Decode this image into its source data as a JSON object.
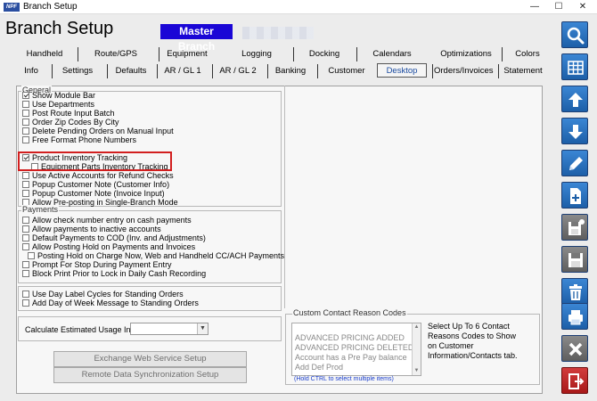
{
  "window": {
    "logo_text": "NPF",
    "title": "Branch Setup",
    "controls": [
      "—",
      "☐",
      "✕"
    ]
  },
  "header": {
    "page_title": "Branch Setup",
    "branch_name": "Master Branch"
  },
  "tabs_row1": [
    "Handheld",
    "Route/GPS",
    "Equipment",
    "Logging",
    "Docking",
    "Calendars",
    "Optimizations",
    "Colors"
  ],
  "tabs_row2": [
    "Info",
    "Settings",
    "Defaults",
    "AR / GL 1",
    "AR / GL 2",
    "Banking",
    "Customer",
    "Desktop",
    "Orders/Invoices",
    "Statement"
  ],
  "active_tab": "Desktop",
  "general": {
    "label": "General",
    "options": [
      {
        "label": "Show Module Bar",
        "checked": true,
        "indent": false
      },
      {
        "label": "Use Departments",
        "checked": false,
        "indent": false
      },
      {
        "label": "Post Route Input Batch",
        "checked": false,
        "indent": false
      },
      {
        "label": "Order Zip Codes By City",
        "checked": false,
        "indent": false
      },
      {
        "label": "Delete Pending Orders on Manual Input",
        "checked": false,
        "indent": false
      },
      {
        "label": "Free Format Phone Numbers",
        "checked": false,
        "indent": false
      },
      {
        "label": "",
        "checked": false,
        "indent": false,
        "blank": true
      },
      {
        "label": "Product Inventory Tracking",
        "checked": true,
        "indent": false
      },
      {
        "label": "Equipment Parts Inventory Tracking",
        "checked": false,
        "indent": true
      },
      {
        "label": "Use Active Accounts for Refund Checks",
        "checked": false,
        "indent": false
      },
      {
        "label": "Popup Customer Note (Customer Info)",
        "checked": false,
        "indent": false
      },
      {
        "label": "Popup Customer Note (Invoice Input)",
        "checked": false,
        "indent": false
      },
      {
        "label": "Allow Pre-posting in Single-Branch Mode",
        "checked": false,
        "indent": false
      }
    ]
  },
  "payments": {
    "label": "Payments",
    "options": [
      {
        "label": "Allow check number entry on cash payments",
        "checked": false,
        "indent": false
      },
      {
        "label": "Allow payments to inactive accounts",
        "checked": false,
        "indent": false
      },
      {
        "label": "Default Payments to COD (Inv. and Adjustments)",
        "checked": false,
        "indent": false
      },
      {
        "label": "Allow Posting Hold on Payments and Invoices",
        "checked": false,
        "indent": false
      },
      {
        "label": "Posting Hold on Charge Now, Web and Handheld CC/ACH Payments",
        "checked": false,
        "indent": true
      },
      {
        "label": "Prompt For Stop During Payment Entry",
        "checked": false,
        "indent": false
      },
      {
        "label": "Block Print Prior to Lock in Daily Cash Recording",
        "checked": false,
        "indent": false
      }
    ]
  },
  "standing_orders": {
    "options": [
      {
        "label": "Use Day Label Cycles for Standing Orders",
        "checked": false
      },
      {
        "label": "Add Day of Week Message to Standing Orders",
        "checked": false
      }
    ]
  },
  "usage": {
    "label": "Calculate Estimated Usage In",
    "value": ""
  },
  "buttons": {
    "exchange": "Exchange Web Service Setup",
    "remote": "Remote Data Synchronization Setup"
  },
  "reason_codes": {
    "label": "Custom Contact Reason Codes",
    "items": [
      "",
      "ADVANCED PRICING ADDED",
      "ADVANCED PRICING DELETED",
      "Account has a Pre Pay balance",
      "Add Def Prod"
    ],
    "hint": "(Hold CTRL to select multiple items)",
    "description": "Select Up To 6 Contact Reasons Codes to Show on Customer Information/Contacts tab."
  },
  "toolbar": [
    {
      "icon": "search-icon",
      "color": "#2a6fbf"
    },
    {
      "icon": "grid-icon",
      "color": "#2a6fbf"
    },
    {
      "icon": "arrow-up-icon",
      "color": "#2a6fbf"
    },
    {
      "icon": "arrow-down-icon",
      "color": "#2a6fbf"
    },
    {
      "icon": "pencil-icon",
      "color": "#2a6fbf"
    },
    {
      "icon": "new-document-icon",
      "color": "#2a6fbf"
    },
    {
      "icon": "save-new-icon",
      "color": "#707070"
    },
    {
      "icon": "save-icon",
      "color": "#707070"
    },
    {
      "icon": "trash-icon",
      "color": "#2a6fbf"
    },
    {
      "icon": "print-icon",
      "color": "#2a6fbf"
    },
    {
      "icon": "cancel-icon",
      "color": "#707070"
    },
    {
      "icon": "exit-icon",
      "color": "#c02424"
    }
  ]
}
